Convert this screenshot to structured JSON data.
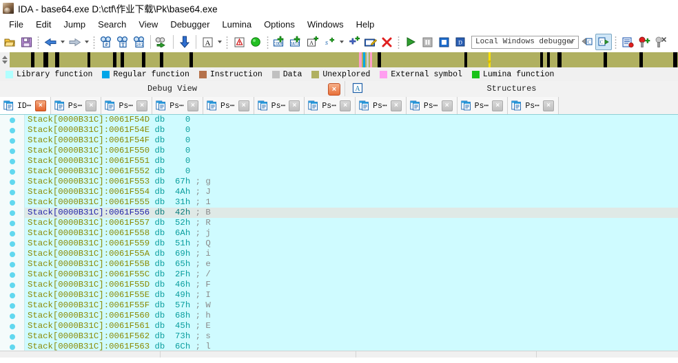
{
  "window": {
    "title": "IDA - base64.exe D:\\ctf\\作业下载\\Pk\\base64.exe",
    "icon": "ida-logo-icon"
  },
  "menubar": {
    "items": [
      {
        "label": "File"
      },
      {
        "label": "Edit"
      },
      {
        "label": "Jump"
      },
      {
        "label": "Search"
      },
      {
        "label": "View"
      },
      {
        "label": "Debugger"
      },
      {
        "label": "Lumina"
      },
      {
        "label": "Options"
      },
      {
        "label": "Windows"
      },
      {
        "label": "Help"
      }
    ]
  },
  "toolbar": {
    "debugger_select_value": "Local Windows debugger",
    "buttons": [
      {
        "name": "open-file-icon"
      },
      {
        "name": "save-icon"
      },
      {
        "name": "back-arrow-icon"
      },
      {
        "name": "forward-arrow-icon"
      },
      {
        "name": "search-hash-icon"
      },
      {
        "name": "search-text-icon"
      },
      {
        "name": "search-immediate-icon"
      },
      {
        "name": "search-next-icon"
      },
      {
        "name": "jump-down-icon"
      },
      {
        "name": "text-view-icon"
      },
      {
        "name": "warning-icon"
      },
      {
        "name": "green-circle-icon"
      },
      {
        "name": "make-code-icon"
      },
      {
        "name": "make-data-icon"
      },
      {
        "name": "make-array-icon"
      },
      {
        "name": "make-string-icon"
      },
      {
        "name": "make-struct-icon"
      },
      {
        "name": "edit-function-icon"
      },
      {
        "name": "undefine-icon"
      },
      {
        "name": "run-icon"
      },
      {
        "name": "pause-icon"
      },
      {
        "name": "stop-icon"
      },
      {
        "name": "step-over-icon"
      },
      {
        "name": "step-into-icon"
      },
      {
        "name": "breakpoint-list-icon"
      },
      {
        "name": "add-breakpoint-icon"
      },
      {
        "name": "delete-breakpoint-icon"
      }
    ]
  },
  "navband": {
    "base_color": "#b0b060",
    "cursor_color": "#ffe200",
    "cursor_pos_pct": 71.6,
    "segments": [
      {
        "left_pct": 3.2,
        "width_pct": 0.55,
        "color": "#000000"
      },
      {
        "left_pct": 5.0,
        "width_pct": 0.75,
        "color": "#000000"
      },
      {
        "left_pct": 6.8,
        "width_pct": 0.6,
        "color": "#000000"
      },
      {
        "left_pct": 11.6,
        "width_pct": 0.5,
        "color": "#000000"
      },
      {
        "left_pct": 15.5,
        "width_pct": 0.45,
        "color": "#000000"
      },
      {
        "left_pct": 16.6,
        "width_pct": 0.5,
        "color": "#000000"
      },
      {
        "left_pct": 19.8,
        "width_pct": 0.5,
        "color": "#000000"
      },
      {
        "left_pct": 22.5,
        "width_pct": 0.5,
        "color": "#000000"
      },
      {
        "left_pct": 26.9,
        "width_pct": 0.5,
        "color": "#000000"
      },
      {
        "left_pct": 52.3,
        "width_pct": 0.35,
        "color": "#ff9ec8"
      },
      {
        "left_pct": 52.9,
        "width_pct": 0.3,
        "color": "#00a6e8"
      },
      {
        "left_pct": 53.4,
        "width_pct": 0.3,
        "color": "#cfcfcf"
      },
      {
        "left_pct": 53.9,
        "width_pct": 0.3,
        "color": "#ff9ec8"
      },
      {
        "left_pct": 55.0,
        "width_pct": 0.55,
        "color": "#000000"
      },
      {
        "left_pct": 68.0,
        "width_pct": 0.5,
        "color": "#000000"
      },
      {
        "left_pct": 79.4,
        "width_pct": 0.4,
        "color": "#000000"
      },
      {
        "left_pct": 80.4,
        "width_pct": 0.4,
        "color": "#000000"
      },
      {
        "left_pct": 82.0,
        "width_pct": 0.55,
        "color": "#000000"
      },
      {
        "left_pct": 88.9,
        "width_pct": 0.5,
        "color": "#000000"
      },
      {
        "left_pct": 94.2,
        "width_pct": 0.5,
        "color": "#000000"
      },
      {
        "left_pct": 99.3,
        "width_pct": 0.55,
        "color": "#000000"
      }
    ]
  },
  "legend": {
    "items": [
      {
        "label": "Library function",
        "color": "#b0ffff"
      },
      {
        "label": "Regular function",
        "color": "#00a6e8"
      },
      {
        "label": "Instruction",
        "color": "#b5714a"
      },
      {
        "label": "Data",
        "color": "#c0c0c0"
      },
      {
        "label": "Unexplored",
        "color": "#b0b060"
      },
      {
        "label": "External symbol",
        "color": "#ff9ef0"
      },
      {
        "label": "Lumina function",
        "color": "#19c219"
      }
    ]
  },
  "docks": [
    {
      "title": "Debug View",
      "icon": "",
      "close_label": "×",
      "has_close": true
    },
    {
      "title": "Structures",
      "icon": "structures-icon",
      "close_label": "",
      "has_close": false
    }
  ],
  "tabs": [
    {
      "label": "ID⋯",
      "active": true,
      "icon": "document-icon",
      "close_label": "×"
    },
    {
      "label": "Ps⋯",
      "active": false,
      "icon": "document-icon",
      "close_label": "×"
    },
    {
      "label": "Ps⋯",
      "active": false,
      "icon": "document-icon",
      "close_label": "×"
    },
    {
      "label": "Ps⋯",
      "active": false,
      "icon": "document-icon",
      "close_label": "×"
    },
    {
      "label": "Ps⋯",
      "active": false,
      "icon": "document-icon",
      "close_label": "×"
    },
    {
      "label": "Ps⋯",
      "active": false,
      "icon": "document-icon",
      "close_label": "×"
    },
    {
      "label": "Ps⋯",
      "active": false,
      "icon": "document-icon",
      "close_label": "×"
    },
    {
      "label": "Ps⋯",
      "active": false,
      "icon": "document-icon",
      "close_label": "×"
    },
    {
      "label": "Ps⋯",
      "active": false,
      "icon": "document-icon",
      "close_label": "×"
    },
    {
      "label": "Ps⋯",
      "active": false,
      "icon": "document-icon",
      "close_label": "×"
    },
    {
      "label": "Ps⋯",
      "active": false,
      "icon": "document-icon",
      "close_label": "×"
    }
  ],
  "disassembly": {
    "background": "#cffbff",
    "selected_index": 9,
    "lines": [
      {
        "seg": "Stack[0000B31C]",
        "addr": "0061F54D",
        "mnem": "db",
        "value": "0",
        "comment": ""
      },
      {
        "seg": "Stack[0000B31C]",
        "addr": "0061F54E",
        "mnem": "db",
        "value": "0",
        "comment": ""
      },
      {
        "seg": "Stack[0000B31C]",
        "addr": "0061F54F",
        "mnem": "db",
        "value": "0",
        "comment": ""
      },
      {
        "seg": "Stack[0000B31C]",
        "addr": "0061F550",
        "mnem": "db",
        "value": "0",
        "comment": ""
      },
      {
        "seg": "Stack[0000B31C]",
        "addr": "0061F551",
        "mnem": "db",
        "value": "0",
        "comment": ""
      },
      {
        "seg": "Stack[0000B31C]",
        "addr": "0061F552",
        "mnem": "db",
        "value": "0",
        "comment": ""
      },
      {
        "seg": "Stack[0000B31C]",
        "addr": "0061F553",
        "mnem": "db",
        "value": "67h",
        "comment": "g"
      },
      {
        "seg": "Stack[0000B31C]",
        "addr": "0061F554",
        "mnem": "db",
        "value": "4Ah",
        "comment": "J"
      },
      {
        "seg": "Stack[0000B31C]",
        "addr": "0061F555",
        "mnem": "db",
        "value": "31h",
        "comment": "1"
      },
      {
        "seg": "Stack[0000B31C]",
        "addr": "0061F556",
        "mnem": "db",
        "value": "42h",
        "comment": "B"
      },
      {
        "seg": "Stack[0000B31C]",
        "addr": "0061F557",
        "mnem": "db",
        "value": "52h",
        "comment": "R"
      },
      {
        "seg": "Stack[0000B31C]",
        "addr": "0061F558",
        "mnem": "db",
        "value": "6Ah",
        "comment": "j"
      },
      {
        "seg": "Stack[0000B31C]",
        "addr": "0061F559",
        "mnem": "db",
        "value": "51h",
        "comment": "Q"
      },
      {
        "seg": "Stack[0000B31C]",
        "addr": "0061F55A",
        "mnem": "db",
        "value": "69h",
        "comment": "i"
      },
      {
        "seg": "Stack[0000B31C]",
        "addr": "0061F55B",
        "mnem": "db",
        "value": "65h",
        "comment": "e"
      },
      {
        "seg": "Stack[0000B31C]",
        "addr": "0061F55C",
        "mnem": "db",
        "value": "2Fh",
        "comment": "/"
      },
      {
        "seg": "Stack[0000B31C]",
        "addr": "0061F55D",
        "mnem": "db",
        "value": "46h",
        "comment": "F"
      },
      {
        "seg": "Stack[0000B31C]",
        "addr": "0061F55E",
        "mnem": "db",
        "value": "49h",
        "comment": "I"
      },
      {
        "seg": "Stack[0000B31C]",
        "addr": "0061F55F",
        "mnem": "db",
        "value": "57h",
        "comment": "W"
      },
      {
        "seg": "Stack[0000B31C]",
        "addr": "0061F560",
        "mnem": "db",
        "value": "68h",
        "comment": "h"
      },
      {
        "seg": "Stack[0000B31C]",
        "addr": "0061F561",
        "mnem": "db",
        "value": "45h",
        "comment": "E"
      },
      {
        "seg": "Stack[0000B31C]",
        "addr": "0061F562",
        "mnem": "db",
        "value": "73h",
        "comment": "s"
      },
      {
        "seg": "Stack[0000B31C]",
        "addr": "0061F563",
        "mnem": "db",
        "value": "6Ch",
        "comment": "l"
      }
    ]
  }
}
